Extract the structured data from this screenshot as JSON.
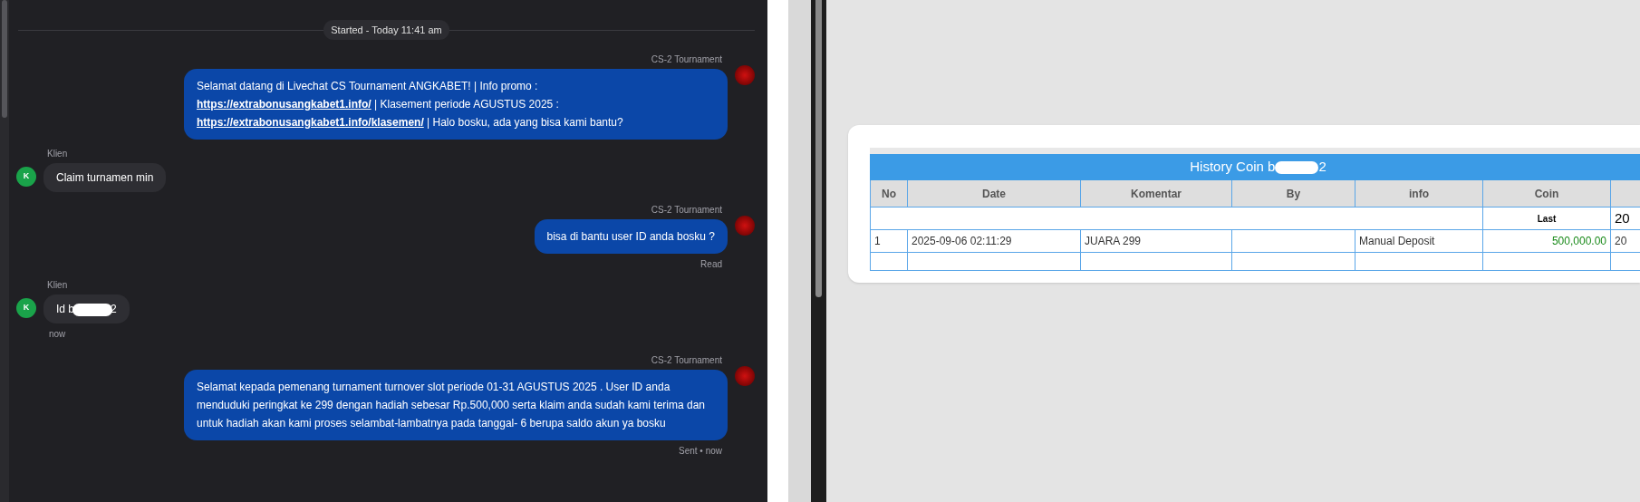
{
  "chat": {
    "session_label": "Started - Today 11:41 am",
    "messages": [
      {
        "kind": "agent",
        "sender": "CS-2 Tournament",
        "segments": [
          {
            "kind": "text",
            "text": "Selamat datang di Livechat CS Tournament ANGKABET! | Info promo : "
          },
          {
            "kind": "link",
            "text": "https://extrabonusangkabet1.info/"
          },
          {
            "kind": "text",
            "text": " | Klasement periode AGUSTUS 2025 : "
          },
          {
            "kind": "link",
            "text": "https://extrabonusangkabet1.info/klasemen/"
          },
          {
            "kind": "text",
            "text": " | Halo bosku, ada yang bisa kami bantu?"
          }
        ]
      },
      {
        "kind": "client",
        "sender": "Klien",
        "avatar": "K",
        "segments": [
          {
            "kind": "text",
            "text": "Claim turnamen min"
          }
        ]
      },
      {
        "kind": "agent",
        "sender": "CS-2 Tournament",
        "segments": [
          {
            "kind": "text",
            "text": "bisa di bantu user ID anda bosku ?"
          }
        ],
        "status": "Read"
      },
      {
        "kind": "client",
        "sender": "Klien",
        "avatar": "K",
        "segments": [
          {
            "kind": "text",
            "text": "Id b"
          },
          {
            "kind": "redaction"
          },
          {
            "kind": "text",
            "text": "2"
          }
        ],
        "status": "now"
      },
      {
        "kind": "agent",
        "sender": "CS-2 Tournament",
        "segments": [
          {
            "kind": "text",
            "text": "Selamat kepada pemenang turnament turnover slot periode 01-31 AGUSTUS 2025 . User ID anda menduduki peringkat ke 299 dengan hadiah sebesar Rp.500,000 serta klaim anda sudah kami terima dan untuk hadiah akan kami proses selambat-lambatnya pada tanggal- 6 berupa saldo akun ya bosku"
          }
        ],
        "status": "Sent • now"
      }
    ]
  },
  "history": {
    "title_before": "History Coin b",
    "title_after": "2",
    "title_redacted": true,
    "columns": [
      "No",
      "Date",
      "Komentar",
      "By",
      "info",
      "Coin",
      ""
    ],
    "summary_row": {
      "label": "Last",
      "column_7": "20"
    },
    "rows": [
      {
        "cells": [
          "1",
          "2025-09-06 02:11:29",
          "JUARA 299",
          "",
          "Manual Deposit",
          "500,000.00",
          "20"
        ],
        "positive": true
      }
    ]
  }
}
